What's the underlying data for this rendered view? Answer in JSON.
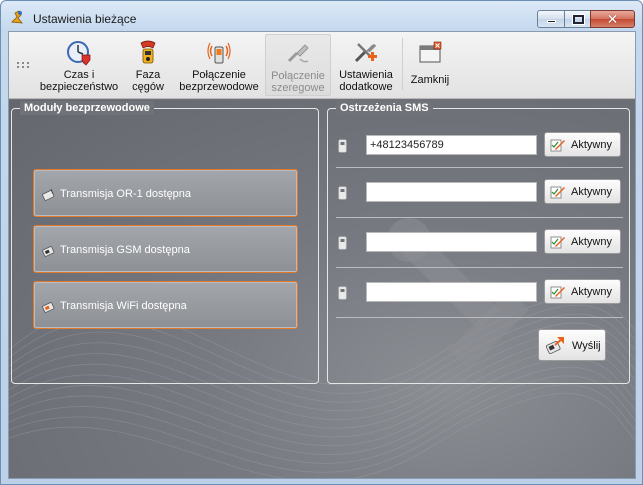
{
  "window": {
    "title": "Ustawienia bieżące"
  },
  "toolbar": {
    "items": [
      {
        "label": "Czas i\nbezpieczeństwo",
        "icon": "clock-shield-icon",
        "enabled": true
      },
      {
        "label": "Faza\ncęgów",
        "icon": "clamp-meter-icon",
        "enabled": true
      },
      {
        "label": "Połączenie\nbezprzewodowe",
        "icon": "wireless-device-icon",
        "enabled": true
      },
      {
        "label": "Połączenie\nszeregowe",
        "icon": "serial-cable-icon",
        "enabled": false
      },
      {
        "label": "Ustawienia\ndodatkowe",
        "icon": "tools-plus-icon",
        "enabled": true
      },
      {
        "label": "Zamknij",
        "icon": "close-window-icon",
        "enabled": true
      }
    ]
  },
  "modules": {
    "title": "Moduły bezprzewodowe",
    "buttons": [
      {
        "label": "Transmisja OR-1 dostępna"
      },
      {
        "label": "Transmisja GSM dostępna"
      },
      {
        "label": "Transmisja WiFi dostępna"
      }
    ]
  },
  "sms": {
    "title": "Ostrzeżenia SMS",
    "rows": [
      {
        "index": "1",
        "value": "+48123456789",
        "button": "Aktywny"
      },
      {
        "index": "2",
        "value": "",
        "button": "Aktywny"
      },
      {
        "index": "3",
        "value": "",
        "button": "Aktywny"
      },
      {
        "index": "4",
        "value": "",
        "button": "Aktywny"
      }
    ],
    "send_label": "Wyślij"
  },
  "colors": {
    "accent_orange": "#e07a2a",
    "panel_bg": "#6f7278",
    "titlebar_close": "#c44a32"
  }
}
